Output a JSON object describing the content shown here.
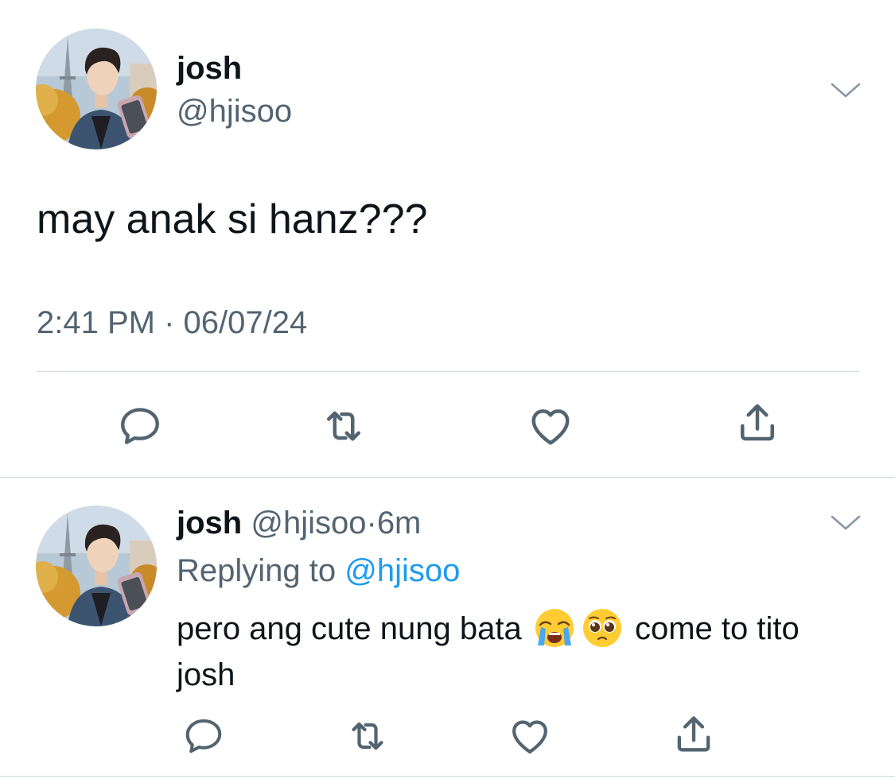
{
  "main_tweet": {
    "display_name": "josh",
    "handle": "@hjisoo",
    "text": "may anak si hanz???",
    "time": "2:41 PM",
    "separator": "·",
    "date": "06/07/24",
    "avatar_icon": "profile-photo",
    "menu_icon": "chevron-down-icon",
    "actions": [
      "reply-icon",
      "retweet-icon",
      "like-icon",
      "share-icon"
    ]
  },
  "reply_tweet": {
    "display_name": "josh",
    "handle": "@hjisoo",
    "separator": "·",
    "age": "6m",
    "replying_label": "Replying to",
    "replying_handle": "@hjisoo",
    "text_before_emoji": "pero ang cute nung bata",
    "emojis": [
      "loudly-crying-face",
      "pleading-face"
    ],
    "text_after_emoji": "come to tito josh",
    "menu_icon": "chevron-down-icon",
    "actions": [
      "reply-icon",
      "retweet-icon",
      "like-icon",
      "share-icon"
    ]
  },
  "colors": {
    "text": "#0f1419",
    "muted": "#536471",
    "link": "#1d9bf0",
    "divider": "#cfd9de"
  }
}
